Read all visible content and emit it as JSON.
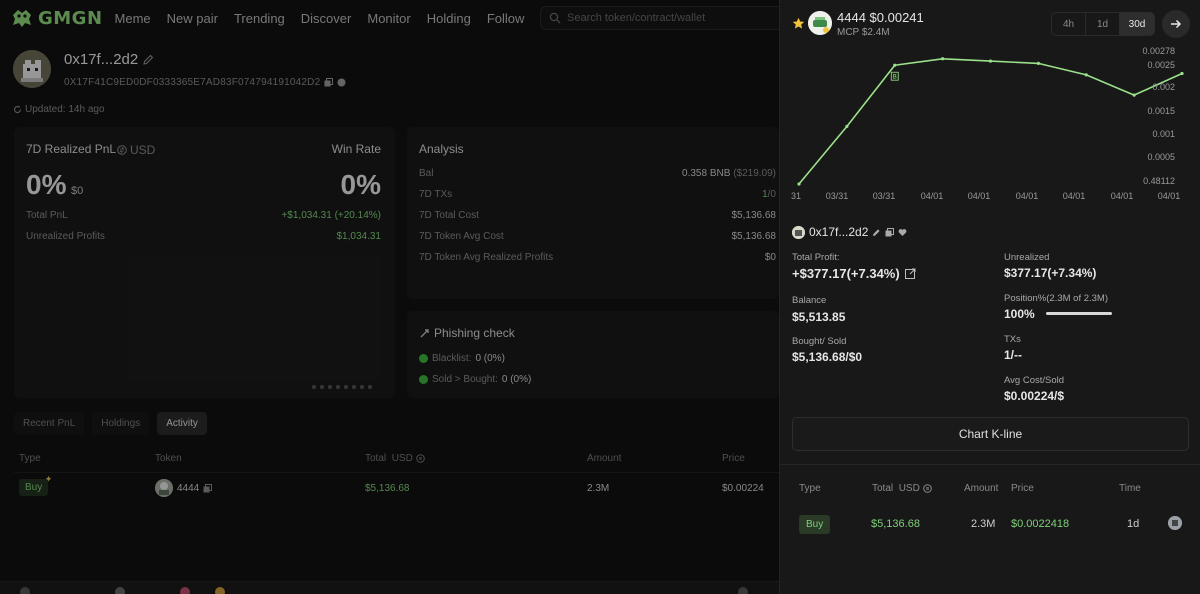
{
  "app": {
    "logo_text": "GMGN",
    "nav": [
      "Meme",
      "New pair",
      "Trending",
      "Discover",
      "Monitor",
      "Holding",
      "Follow"
    ],
    "search_placeholder": "Search token/contract/wallet"
  },
  "profile": {
    "name": "0x17f...2d2",
    "address": "0X17F41C9ED0DF0333365E7AD83F074794191042D2",
    "updated": "Updated: 14h ago"
  },
  "pnl_panel": {
    "title": "7D Realized PnL",
    "currency": "USD",
    "win_rate_label": "Win Rate",
    "pnl_value": "0%",
    "pnl_amount": "$0",
    "win_rate_value": "0%",
    "rows": [
      {
        "label": "Total PnL",
        "value": "+$1,034.31 (+20.14%)"
      },
      {
        "label": "Unrealized Profits",
        "value": "$1,034.31"
      }
    ]
  },
  "analysis": {
    "title": "Analysis",
    "rows": [
      {
        "label": "Bal",
        "value": "0.358 BNB",
        "sub": "($219.09)"
      },
      {
        "label": "7D TXs",
        "value": "1",
        "sub": "/0"
      },
      {
        "label": "7D Total Cost",
        "value": "$5,136.68",
        "sub": ""
      },
      {
        "label": "7D Token Avg Cost",
        "value": "$5,136.68",
        "sub": ""
      },
      {
        "label": "7D Token Avg Realized Profits",
        "value": "$0",
        "sub": ""
      }
    ]
  },
  "phishing": {
    "title": "Phishing check",
    "rows": [
      {
        "label": "Blacklist:",
        "value": "0 (0%)"
      },
      {
        "label": "Sold > Bought:",
        "value": "0 (0%)"
      }
    ]
  },
  "tabs": [
    "Recent PnL",
    "Holdings",
    "Activity"
  ],
  "activity_table": {
    "headers": {
      "type": "Type",
      "token": "Token",
      "total": "Total",
      "total_unit": "USD",
      "amount": "Amount",
      "price": "Price"
    },
    "row": {
      "type": "Buy",
      "token": "4444",
      "total": "$5,136.68",
      "amount": "2.3M",
      "price": "$0.00224"
    }
  },
  "drawer": {
    "token_title": "4444 $0.00241",
    "mcp": "MCP $2.4M",
    "timeframes": [
      "4h",
      "1d",
      "30d"
    ],
    "active_timeframe": "30d",
    "wallet_name": "0x17f...2d2",
    "stats": {
      "total_profit_label": "Total Profit:",
      "total_profit_value": "+$377.17(+7.34%)",
      "unrealized_label": "Unrealized",
      "unrealized_value": "$377.17(+7.34%)",
      "balance_label": "Balance",
      "balance_value": "$5,513.85",
      "position_label": "Position%(2.3M of 2.3M)",
      "position_value": "100%",
      "bought_sold_label": "Bought/ Sold",
      "bought_sold_value": "$5,136.68/$0",
      "txs_label": "TXs",
      "txs_value": "1/--",
      "avg_label": "Avg Cost/Sold",
      "avg_value": "$0.00224/$"
    },
    "kline_button": "Chart K-line",
    "table": {
      "headers": {
        "type": "Type",
        "total": "Total",
        "total_unit": "USD",
        "amount": "Amount",
        "price": "Price",
        "time": "Time"
      },
      "row": {
        "type": "Buy",
        "total": "$5,136.68",
        "amount": "2.3M",
        "price": "$0.0022418",
        "time": "1d"
      }
    }
  },
  "colors": {
    "accent_green": "#7ed07a",
    "line_green": "#9be08a",
    "bg": "#111111",
    "panel": "#1a1a1a"
  },
  "chart_data": {
    "type": "line",
    "x": [
      "31",
      "03/31",
      "03/31",
      "04/01",
      "04/01",
      "04/01",
      "04/01",
      "04/01",
      "04/01"
    ],
    "y_ticks": [
      "0.00278",
      "0.0025",
      "0.002",
      "0.0015",
      "0.001",
      "0.0005",
      "0.48112"
    ],
    "ylim": [
      0,
      0.00278
    ],
    "series": [
      {
        "values": [
          0.0,
          0.00125,
          0.00258,
          0.00272,
          0.00267,
          0.00262,
          0.00237,
          0.00193,
          0.0024
        ]
      }
    ],
    "buy_marker": {
      "label": "B",
      "index": 2
    }
  }
}
